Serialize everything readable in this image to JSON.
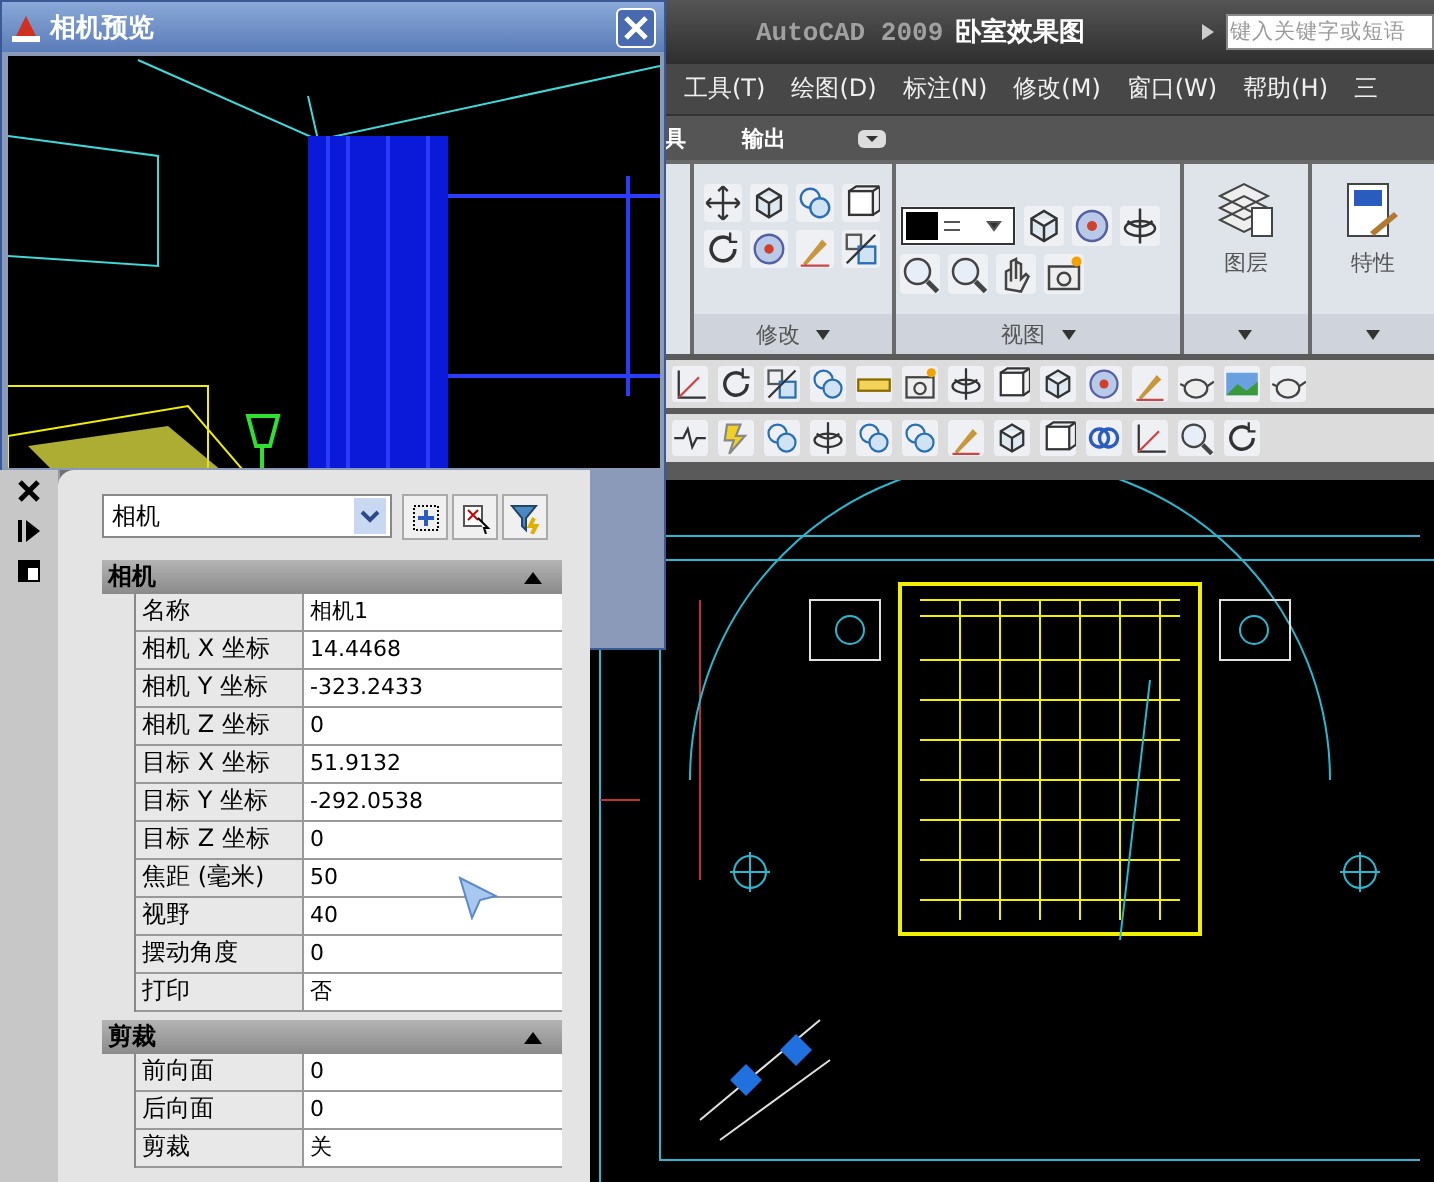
{
  "preview_window": {
    "title": "相机预览"
  },
  "main_window": {
    "app": "AutoCAD 2009",
    "document": "卧室效果图",
    "search": {
      "placeholder": "键入关键字或短语"
    }
  },
  "menu": [
    "工具(T)",
    "绘图(D)",
    "标注(N)",
    "修改(M)",
    "窗口(W)",
    "帮助(H)",
    "三"
  ],
  "ribbon_tabs": [
    "具",
    "输出"
  ],
  "ribbon_panels": [
    {
      "title": "修改"
    },
    {
      "title": "视图"
    },
    {
      "title": "图层"
    },
    {
      "title": "特性"
    }
  ],
  "palette": {
    "selector": "相机",
    "sections": [
      {
        "title": "相机",
        "expanded": true,
        "rows": [
          {
            "name": "名称",
            "value": "相机1"
          },
          {
            "name": "相机 X 坐标",
            "value": "14.4468"
          },
          {
            "name": "相机 Y 坐标",
            "value": "-323.2433"
          },
          {
            "name": "相机 Z 坐标",
            "value": "0"
          },
          {
            "name": "目标 X 坐标",
            "value": "51.9132"
          },
          {
            "name": "目标 Y 坐标",
            "value": "-292.0538"
          },
          {
            "name": "目标 Z 坐标",
            "value": "0"
          },
          {
            "name": "焦距 (毫米)",
            "value": "50"
          },
          {
            "name": "视野",
            "value": "40"
          },
          {
            "name": "摆动角度",
            "value": "0"
          },
          {
            "name": "打印",
            "value": "否"
          }
        ]
      },
      {
        "title": "剪裁",
        "expanded": true,
        "rows": [
          {
            "name": "前向面",
            "value": "0"
          },
          {
            "name": "后向面",
            "value": "0"
          },
          {
            "name": "剪裁",
            "value": "关"
          }
        ]
      }
    ]
  }
}
